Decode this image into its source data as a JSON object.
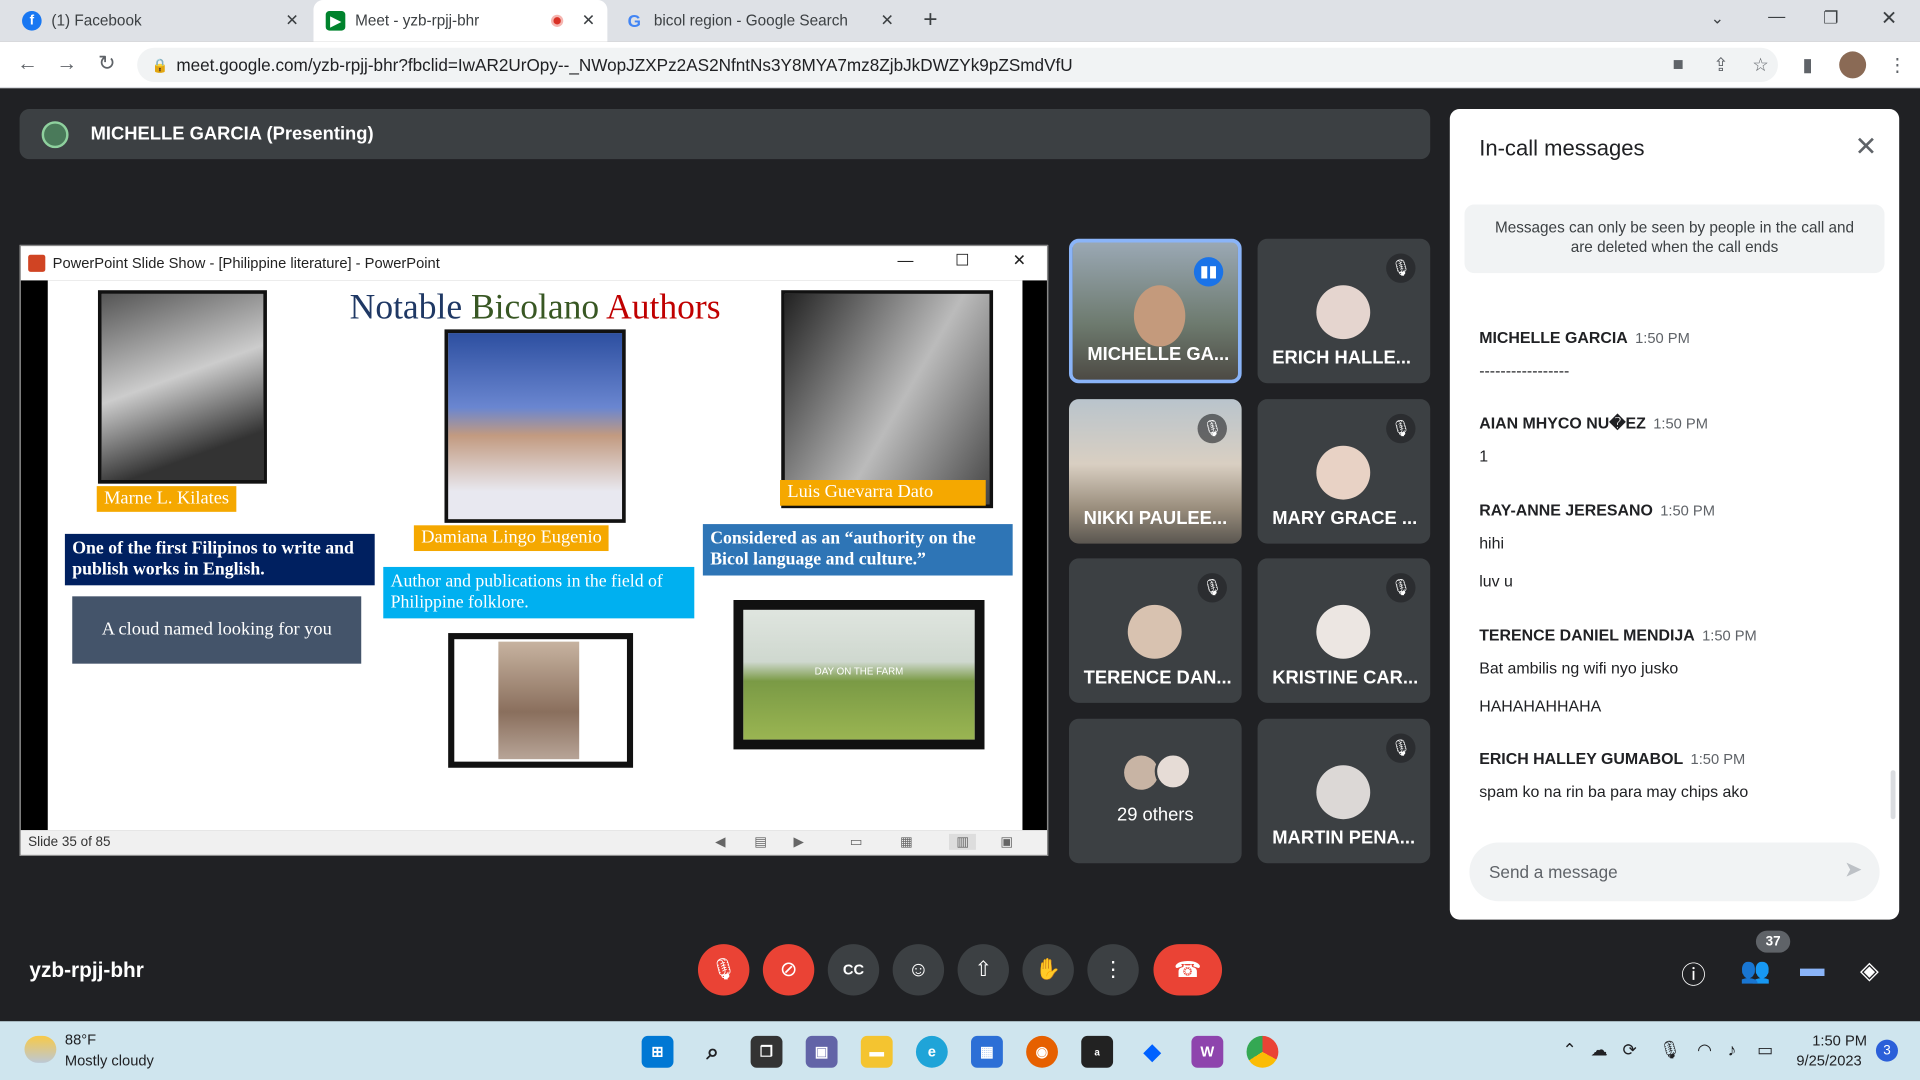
{
  "browser": {
    "tabs": [
      {
        "label": "(1) Facebook",
        "icon": "facebook-icon"
      },
      {
        "label": "Meet - yzb-rpjj-bhr",
        "icon": "google-meet-icon"
      },
      {
        "label": "bicol region - Google Search",
        "icon": "google-icon"
      }
    ],
    "new_tab": "+",
    "url": "meet.google.com/yzb-rpjj-bhr?fbclid=IwAR2UrOpy--_NWopJZXPz2AS2NfntNs3Y8MYA7mz8ZjbJkDWZYk9pZSmdVfU"
  },
  "meet": {
    "presenting_label": "MICHELLE GARCIA (Presenting)",
    "meeting_code": "yzb-rpjj-bhr",
    "participant_count": "37"
  },
  "ppt": {
    "window_title": "PowerPoint Slide Show - [Philippine literature] - PowerPoint",
    "status": "Slide 35 of 85",
    "slide": {
      "title_word1": "Notable",
      "title_word2": "Bicolano",
      "title_word3": "Authors",
      "author1_name": "Marne L. Kilates",
      "author1_desc": "One of the first Filipinos to write and publish works in English.",
      "author1_work": "A cloud named looking for you",
      "author2_name": "Damiana Lingo Eugenio",
      "author2_desc": "Author and publications in the field of Philippine folklore.",
      "author3_name": "Luis Guevarra Dato",
      "author3_desc": "Considered as an “authority on the Bicol language and culture.”",
      "author3_work": "DAY ON THE FARM"
    }
  },
  "participants": [
    {
      "name": "MICHELLE GA...",
      "muted": false,
      "speaking": true
    },
    {
      "name": "ERICH HALLE...",
      "muted": true
    },
    {
      "name": "NIKKI PAULEE...",
      "muted": true
    },
    {
      "name": "MARY GRACE ...",
      "muted": true
    },
    {
      "name": "TERENCE DAN...",
      "muted": true
    },
    {
      "name": "KRISTINE CAR...",
      "muted": true
    },
    {
      "name": "29 others",
      "muted": false
    },
    {
      "name": "MARTIN PENA...",
      "muted": true
    }
  ],
  "chat": {
    "title": "In-call messages",
    "note": "Messages can only be seen by people in the call and are deleted when the call ends",
    "messages": [
      {
        "sender": "MICHELLE GARCIA",
        "time": "1:50 PM",
        "lines": [
          "-----------------"
        ]
      },
      {
        "sender": "AIAN MHYCO NU�EZ",
        "time": "1:50 PM",
        "lines": [
          "1"
        ]
      },
      {
        "sender": "RAY-ANNE JERESANO",
        "time": "1:50 PM",
        "lines": [
          "hihi",
          "luv u"
        ]
      },
      {
        "sender": "TERENCE DANIEL MENDIJA",
        "time": "1:50 PM",
        "lines": [
          "Bat ambilis ng wifi nyo jusko",
          "HAHAHAHHAHA"
        ]
      },
      {
        "sender": "ERICH HALLEY GUMABOL",
        "time": "1:50 PM",
        "lines": [
          "spam ko na rin ba para may chips ako"
        ]
      }
    ],
    "input_placeholder": "Send a message"
  },
  "taskbar": {
    "temperature": "88°F",
    "weather": "Mostly cloudy",
    "time": "1:50 PM",
    "date": "9/25/2023",
    "notifications": "3"
  }
}
